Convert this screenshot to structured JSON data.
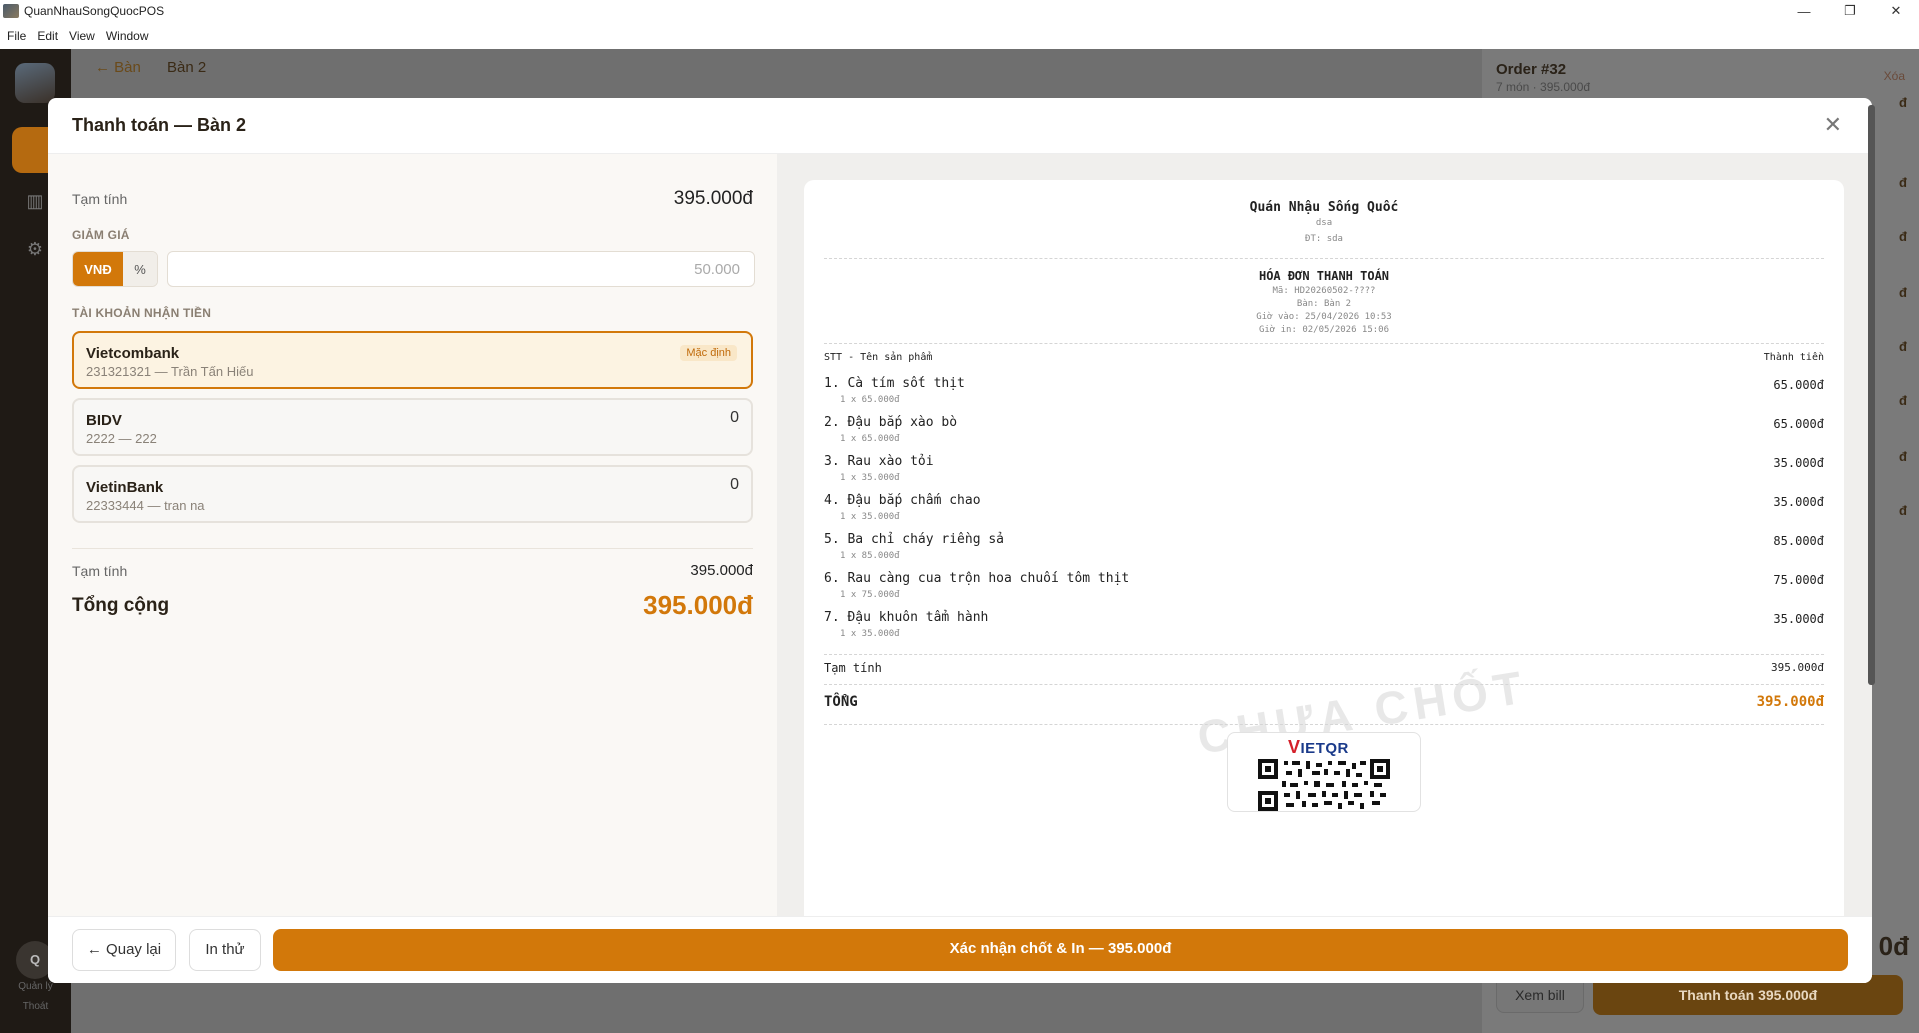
{
  "window": {
    "title": "QuanNhauSongQuocPOS",
    "minimize": "—",
    "maximize": "❐",
    "close": "✕"
  },
  "menu": [
    "File",
    "Edit",
    "View",
    "Window"
  ],
  "background": {
    "breadcrumb_back": "← Bàn",
    "breadcrumb_current": "Bàn 2",
    "user_initial": "Q",
    "user_label": "Quản lý",
    "logout_label": "Thoát",
    "order_title": "Order #32",
    "order_sub": "7 món · 395.000đ",
    "order_clear": "Xóa",
    "order_marks": [
      "đ",
      "đ",
      "đ",
      "đ",
      "đ",
      "đ",
      "đ",
      "đ"
    ],
    "order_total_big": "0đ",
    "view_bill": "Xem bill",
    "pay_button": "Thanh toán 395.000đ"
  },
  "modal": {
    "title": "Thanh toán — Bàn 2",
    "close_icon": "✕",
    "subtotal_label": "Tạm tính",
    "subtotal_value": "395.000đ",
    "discount_section": "GIẢM GIÁ",
    "discount_modes": [
      "VNĐ",
      "%"
    ],
    "discount_placeholder": "50.000",
    "accounts_section": "TÀI KHOẢN NHẬN TIỀN",
    "accounts": [
      {
        "bank": "Vietcombank",
        "detail": "231321321 — Trần Tấn Hiếu",
        "badge": "Mặc định",
        "amount": ""
      },
      {
        "bank": "BIDV",
        "detail": "2222 — 222",
        "badge": "",
        "amount": "0"
      },
      {
        "bank": "VietinBank",
        "detail": "22333444 — tran na",
        "badge": "",
        "amount": "0"
      }
    ],
    "summary_subtotal_label": "Tạm tính",
    "summary_subtotal_value": "395.000đ",
    "summary_total_label": "Tổng cộng",
    "summary_total_value": "395.000đ",
    "accent_color": "#d2780a"
  },
  "receipt": {
    "shop_name": "Quán Nhậu Sống Quốc",
    "address": "dsa",
    "phone": "ĐT: sda",
    "heading": "HÓA ĐƠN THANH TOÁN",
    "code": "Mã: HD20260502-????",
    "table": "Bàn: Bàn 2",
    "time_in": "Giờ vào: 25/04/2026 10:53",
    "time_print": "Giờ in: 02/05/2026 15:06",
    "col_product": "STT - Tên sản phẩm",
    "col_amount": "Thành tiền",
    "items": [
      {
        "name": "1. Cà tím sốt thịt",
        "qty": "1 x 65.000đ",
        "total": "65.000đ"
      },
      {
        "name": "2. Đậu bắp xào bò",
        "qty": "1 x 65.000đ",
        "total": "65.000đ"
      },
      {
        "name": "3. Rau xào tỏi",
        "qty": "1 x 35.000đ",
        "total": "35.000đ"
      },
      {
        "name": "4. Đậu bắp chấm chao",
        "qty": "1 x 35.000đ",
        "total": "35.000đ"
      },
      {
        "name": "5. Ba chỉ cháy riềng sả",
        "qty": "1 x 85.000đ",
        "total": "85.000đ"
      },
      {
        "name": "6. Rau càng cua trộn hoa chuối tôm thịt",
        "qty": "1 x 75.000đ",
        "total": "75.000đ"
      },
      {
        "name": "7. Đậu khuôn tẩm hành",
        "qty": "1 x 35.000đ",
        "total": "35.000đ"
      }
    ],
    "subtotal_label": "Tạm tính",
    "subtotal_value": "395.000đ",
    "total_label": "TỔNG",
    "total_value": "395.000đ",
    "watermark": "CHƯA CHỐT",
    "qr_logo_v": "V",
    "qr_logo_rest": "IETQR"
  },
  "footer": {
    "back_label": "← Quay lại",
    "test_print_label": "In thử",
    "confirm_label": "Xác nhận chốt & In — 395.000đ"
  }
}
